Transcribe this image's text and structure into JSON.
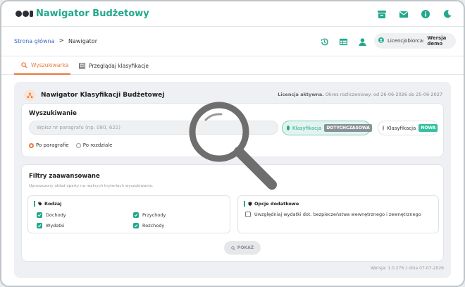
{
  "app": {
    "name": "Nawigator Budżetowy"
  },
  "breadcrumb": {
    "home": "Strona główna",
    "separator": ">",
    "current": "Nawigator"
  },
  "license_pill": {
    "label": "Licencjobiorca:",
    "value": "Wersja demo"
  },
  "tabs": [
    {
      "label": "Wyszukiwarka",
      "active": true,
      "icon": "search-icon"
    },
    {
      "label": "Przeglądaj klasyfikacje",
      "active": false,
      "icon": "list-icon"
    }
  ],
  "panel": {
    "title": "Nawigator Klasyfikacji Budżetowej",
    "license_status": "Licencja aktywna.",
    "license_period": "Okres rozliczeniowy: od 26-06-2026 do 25-06-2027"
  },
  "search": {
    "heading": "Wyszukiwanie",
    "placeholder": "Wpisz nr paragrafu (np. 080, 621)",
    "klas_current_label": "Klasyfikacja",
    "klas_current_badge": "DOTYCHCZASOWA",
    "klas_new_label": "Klasyfikacja",
    "klas_new_badge": "NOWA",
    "radio_paragraph": "Po paragrafie",
    "radio_section": "Po rozdziale"
  },
  "filters": {
    "heading": "Filtry zaawansowane",
    "subtitle": "Uproszczony układ oparty na realnych kryteriach wyszukiwania.",
    "type_title": "Rodzaj",
    "items": {
      "dochody": "Dochody",
      "wydatki": "Wydatki",
      "przychody": "Przychody",
      "rozchody": "Rozchody"
    },
    "options_title": "Opcje dodatkowe",
    "option_security": "Uwzględniaj wydatki dot. bezpieczeństwa wewnętrznego i zewnętrznego",
    "show_button": "POKAŻ"
  },
  "version": "Wersja: 1.0.276 z dnia 07-07-2026",
  "colors": {
    "accent": "#22a88b",
    "tab_active": "#e8793b"
  }
}
